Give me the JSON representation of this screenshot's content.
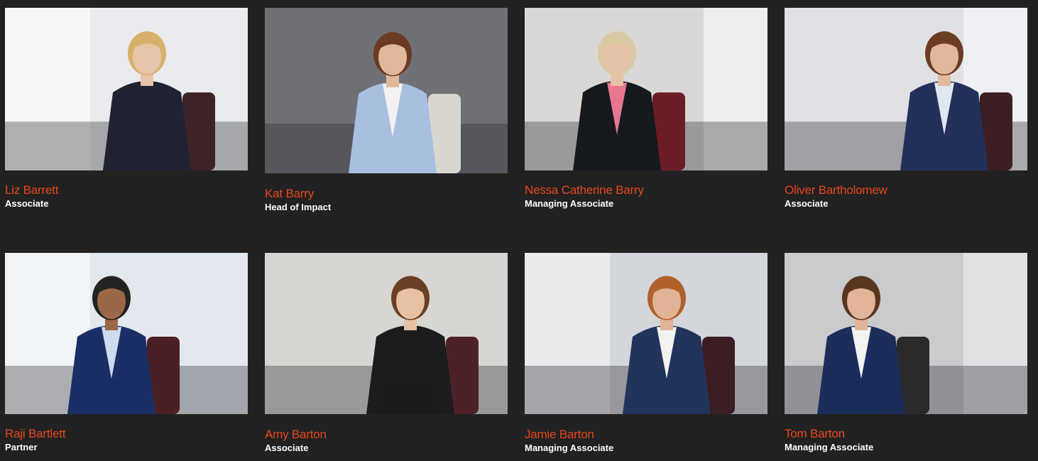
{
  "people": [
    {
      "name": "Liz Barrett",
      "role": "Associate",
      "colors": {
        "bg": "#e9ebee",
        "wall": "#f6f7f8",
        "suit": "#1e2233",
        "skin": "#e8c4aa",
        "hair": "#d7b16b",
        "shirt": "#1e2233",
        "chair": "#3d2226"
      }
    },
    {
      "name": "Kat Barry",
      "role": "Head of Impact",
      "colors": {
        "bg": "#6f7075",
        "wall": "#8c8c90",
        "suit": "#a9bfe0",
        "skin": "#e2b89c",
        "hair": "#6a3a22",
        "shirt": "#f2f2f2",
        "chair": "#d9d6d0"
      }
    },
    {
      "name": "Nessa Catherine Barry",
      "role": "Managing Associate",
      "colors": {
        "bg": "#d9d8d6",
        "wall": "#eeeeec",
        "suit": "#15191e",
        "skin": "#e6c3a8",
        "hair": "#d9c9a2",
        "shirt": "#e8768e",
        "chair": "#6c1c24"
      }
    },
    {
      "name": "Oliver Bartholomew",
      "role": "Associate",
      "colors": {
        "bg": "#e0e1e5",
        "wall": "#eef0f3",
        "suit": "#23305a",
        "skin": "#e3b89a",
        "hair": "#6a3c22",
        "shirt": "#dfe7f1",
        "chair": "#3b1e22"
      }
    },
    {
      "name": "Raji Bartlett",
      "role": "Partner",
      "colors": {
        "bg": "#e3e8ee",
        "wall": "#f2f5f8",
        "suit": "#1b2f66",
        "skin": "#9a6847",
        "hair": "#232323",
        "shirt": "#cfdcef",
        "chair": "#4a2025"
      }
    },
    {
      "name": "Amy Barton",
      "role": "Associate",
      "colors": {
        "bg": "#d8d6d2",
        "wall": "#ebe9e6",
        "suit": "#1c1c1c",
        "skin": "#e8c1a4",
        "hair": "#6b3f23",
        "shirt": "#1c1c1c",
        "chair": "#4d2227"
      }
    },
    {
      "name": "Jamie Barton",
      "role": "Managing Associate",
      "colors": {
        "bg": "#d3d6da",
        "wall": "#e8eaec",
        "suit": "#22345c",
        "skin": "#e2b497",
        "hair": "#b0612c",
        "shirt": "#f2f2f0",
        "chair": "#3c1d22"
      }
    },
    {
      "name": "Tom Barton",
      "role": "Managing Associate",
      "colors": {
        "bg": "#c9cbcd",
        "wall": "#dfe1e2",
        "suit": "#1c2d5a",
        "skin": "#e2b598",
        "hair": "#5a3620",
        "shirt": "#f3f3f3",
        "chair": "#2a2a2a"
      }
    }
  ]
}
